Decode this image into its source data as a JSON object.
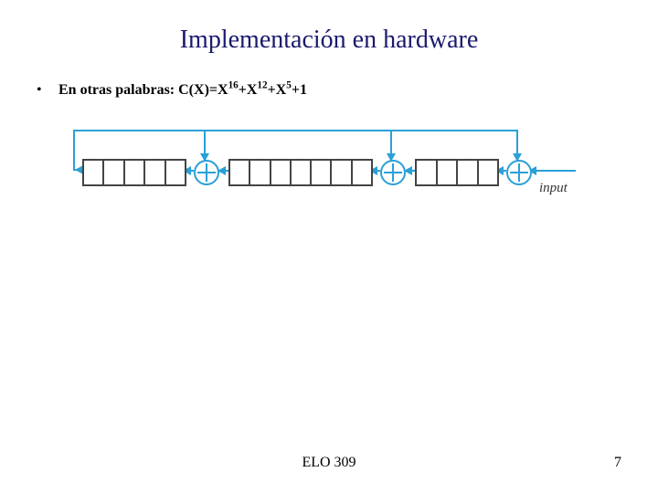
{
  "title": "Implementación en hardware",
  "bullet": {
    "label_prefix": "En otras palabras: ",
    "formula_parts": [
      "C(X)=X",
      "16",
      "+X",
      "12",
      "+X",
      "5",
      "+1"
    ]
  },
  "diagram": {
    "input_label": "input",
    "registers": [
      {
        "name": "reg-low-5",
        "cells": 5
      },
      {
        "name": "reg-mid-7",
        "cells": 7
      },
      {
        "name": "reg-high-4",
        "cells": 4
      }
    ],
    "xor_count": 3,
    "polynomial": "X^16 + X^12 + X^5 + 1"
  },
  "footer": {
    "center": "ELO 309",
    "page": "7"
  },
  "chart_data": {
    "type": "table",
    "title": "CRC-CCITT LFSR hardware diagram",
    "polynomial": "C(X) = X^16 + X^12 + X^5 + 1",
    "shift_register_bits": 16,
    "tap_positions": [
      5,
      12,
      16
    ],
    "stages": [
      {
        "bits": 5,
        "followed_by_xor": true
      },
      {
        "bits": 7,
        "followed_by_xor": true
      },
      {
        "bits": 4,
        "followed_by_xor": true
      }
    ],
    "feedback_from_bit": 0,
    "input_side": "right"
  }
}
